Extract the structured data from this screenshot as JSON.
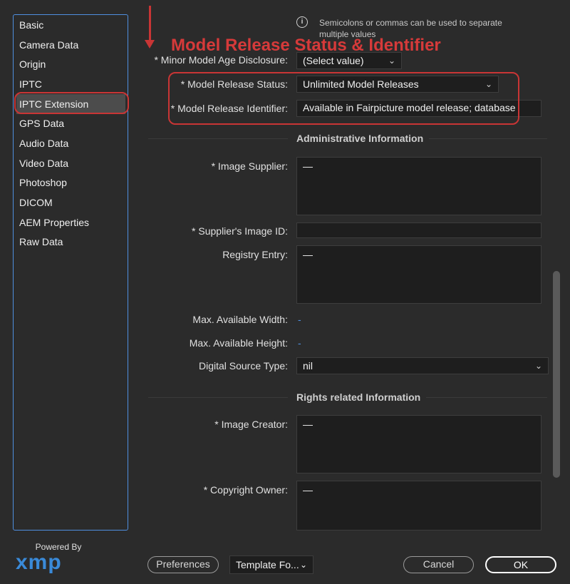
{
  "sidebar": {
    "items": [
      {
        "label": "Basic"
      },
      {
        "label": "Camera Data"
      },
      {
        "label": "Origin"
      },
      {
        "label": "IPTC"
      },
      {
        "label": "IPTC Extension"
      },
      {
        "label": "GPS Data"
      },
      {
        "label": "Audio Data"
      },
      {
        "label": "Video Data"
      },
      {
        "label": "Photoshop"
      },
      {
        "label": "DICOM"
      },
      {
        "label": "AEM Properties"
      },
      {
        "label": "Raw Data"
      }
    ],
    "active": "IPTC Extension"
  },
  "logo": {
    "powered_by": "Powered By",
    "name": "xmp"
  },
  "info": {
    "text": "Semicolons or commas can be used to separate multiple values"
  },
  "annotation": {
    "title": "Model Release Status & Identifier",
    "color": "#d63a3a"
  },
  "form": {
    "minor_age": {
      "label": "* Minor Model Age Disclosure:",
      "value": "(Select value)"
    },
    "release_status": {
      "label": "* Model Release Status:",
      "value": "Unlimited Model Releases"
    },
    "release_id": {
      "label": "* Model Release Identifier:",
      "value": "Available in Fairpicture model release; database"
    },
    "admin_section": "Administrative Information",
    "image_supplier": {
      "label": "* Image Supplier:",
      "value": "—"
    },
    "supplier_image_id": {
      "label": "* Supplier's Image ID:",
      "value": ""
    },
    "registry_entry": {
      "label": "Registry Entry:",
      "value": "—"
    },
    "max_width": {
      "label": "Max. Available Width:",
      "value": "-"
    },
    "max_height": {
      "label": "Max. Available Height:",
      "value": "-"
    },
    "digital_source_type": {
      "label": "Digital Source Type:",
      "value": "nil"
    },
    "rights_section": "Rights related Information",
    "image_creator": {
      "label": "* Image Creator:",
      "value": "—"
    },
    "copyright_owner": {
      "label": "* Copyright Owner:",
      "value": "—"
    }
  },
  "footer": {
    "preferences": "Preferences",
    "template": "Template Fo...",
    "cancel": "Cancel",
    "ok": "OK"
  }
}
